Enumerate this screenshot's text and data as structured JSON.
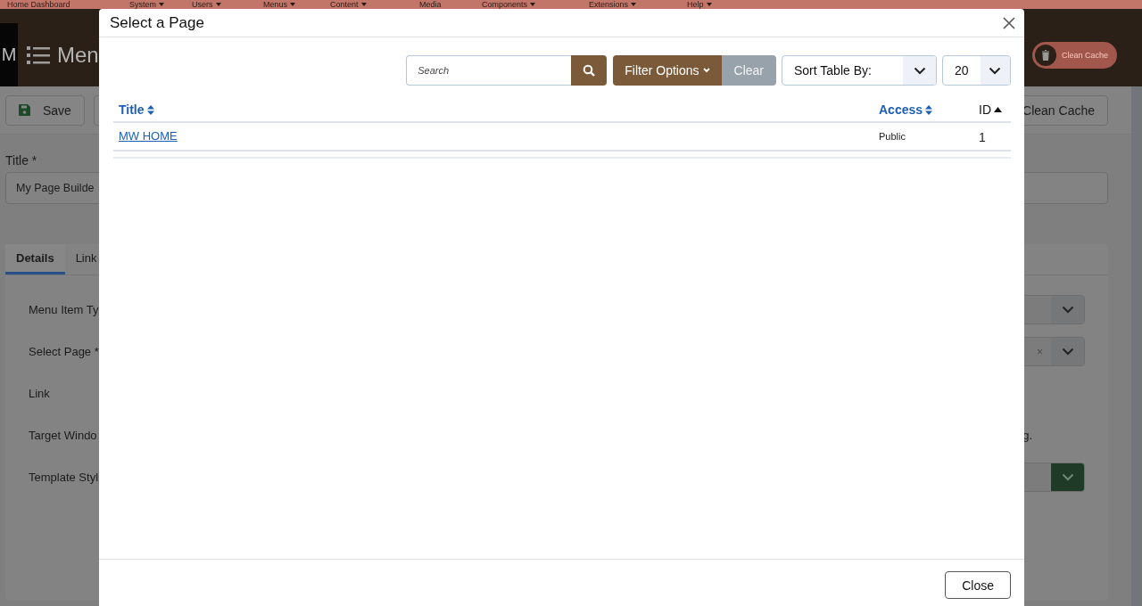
{
  "nav": {
    "items": [
      {
        "label": "Home Dashboard",
        "has_menu": false
      },
      {
        "label": "System",
        "has_menu": true
      },
      {
        "label": "Users",
        "has_menu": true
      },
      {
        "label": "Menus",
        "has_menu": true
      },
      {
        "label": "Content",
        "has_menu": true
      },
      {
        "label": "Media",
        "has_menu": false
      },
      {
        "label": "Components",
        "has_menu": true
      },
      {
        "label": "Extensions",
        "has_menu": true
      },
      {
        "label": "Help",
        "has_menu": true
      }
    ]
  },
  "header": {
    "logo": "M",
    "title": "Men",
    "clean_cache": "Clean Cache"
  },
  "toolbar": {
    "save": "Save",
    "clean_cache": "Clean Cache"
  },
  "form": {
    "title_label": "Title *",
    "title_value": "My Page Builde",
    "tabs": [
      {
        "label": "Details",
        "selected": true
      },
      {
        "label": "Link",
        "selected": false
      }
    ],
    "fields": [
      {
        "label": "Menu Item Ty",
        "kind": "select"
      },
      {
        "label": "Select Page *",
        "kind": "clearable"
      },
      {
        "label": "Link",
        "kind": "none"
      },
      {
        "label": "Target Windo",
        "kind": "note",
        "note": "g."
      },
      {
        "label": "Template Styl",
        "kind": "green"
      }
    ],
    "clear_mark": "×"
  },
  "modal": {
    "title": "Select a Page",
    "search": {
      "placeholder": "Search"
    },
    "filter": "Filter Options",
    "clear": "Clear",
    "sort": "Sort Table By:",
    "limit": "20",
    "columns": [
      {
        "label": "Title",
        "sorted": false
      },
      {
        "label": "Access",
        "sorted": false
      },
      {
        "label": "ID",
        "sorted": true
      }
    ],
    "rows": [
      {
        "title": "MW HOME",
        "access": "Public",
        "id": "1"
      }
    ],
    "close": "Close"
  }
}
